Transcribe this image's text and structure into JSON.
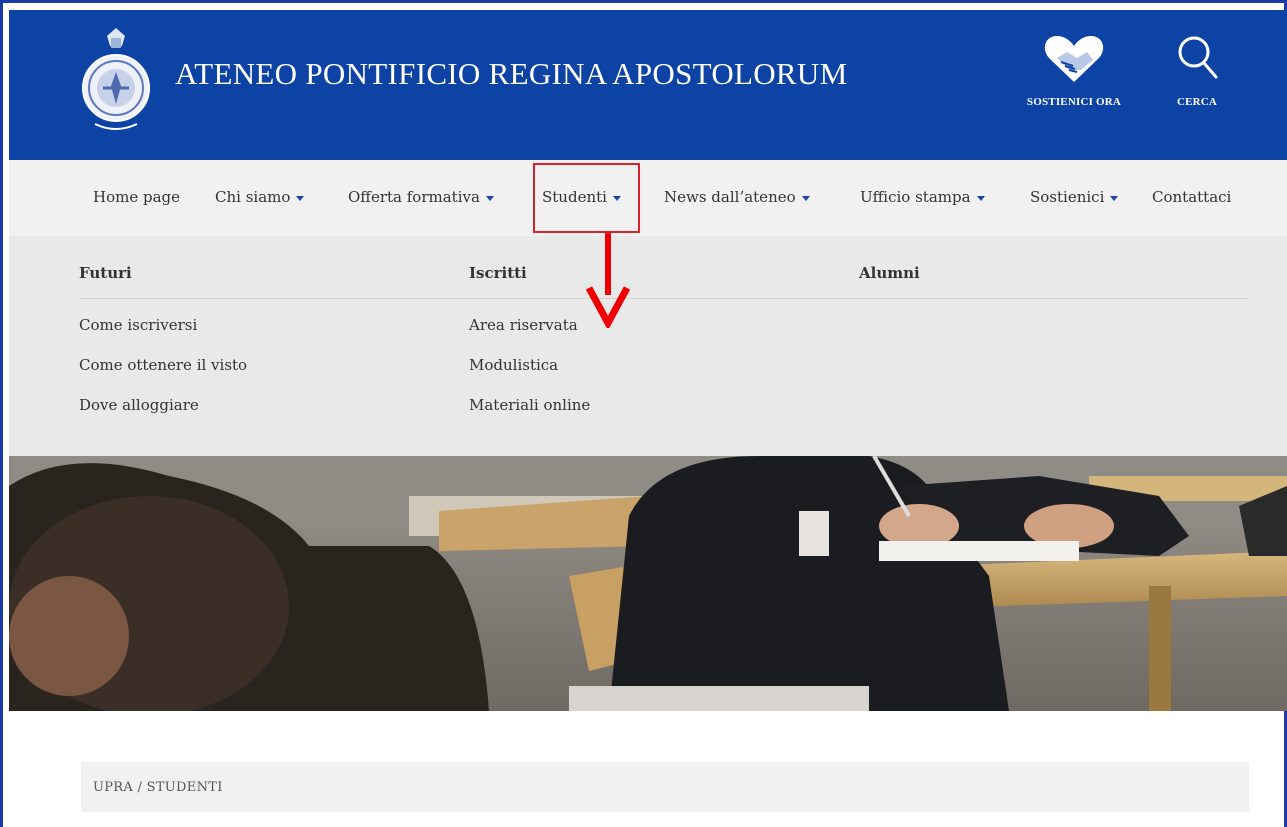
{
  "header": {
    "title": "ATENEO PONTIFICIO REGINA APOSTOLORUM",
    "donate_label": "SOSTIENICI ORA",
    "search_label": "CERCA",
    "logo_icon": "university-seal-logo",
    "donate_icon": "heart-handshake-icon",
    "search_icon": "magnifier-icon",
    "bg_color": "#0c43a4"
  },
  "nav": {
    "items": [
      {
        "label": "Home page",
        "dropdown": false
      },
      {
        "label": "Chi siamo",
        "dropdown": true
      },
      {
        "label": "Offerta formativa",
        "dropdown": true
      },
      {
        "label": "Studenti",
        "dropdown": true,
        "highlighted": true
      },
      {
        "label": "News dall’ateneo",
        "dropdown": true
      },
      {
        "label": "Ufficio stampa",
        "dropdown": true
      },
      {
        "label": "Sostienici",
        "dropdown": true
      },
      {
        "label": "Contattaci",
        "dropdown": false
      }
    ],
    "highlight_color": "#d8232a"
  },
  "dropdown": {
    "columns": [
      {
        "heading": "Futuri",
        "links": [
          "Come iscriversi",
          "Come ottenere il visto",
          "Dove alloggiare"
        ]
      },
      {
        "heading": "Iscritti",
        "links": [
          "Area riservata",
          "Modulistica",
          "Materiali online"
        ]
      },
      {
        "heading": "Alumni",
        "links": []
      }
    ]
  },
  "breadcrumb": {
    "text": "UPRA / STUDENTI"
  }
}
